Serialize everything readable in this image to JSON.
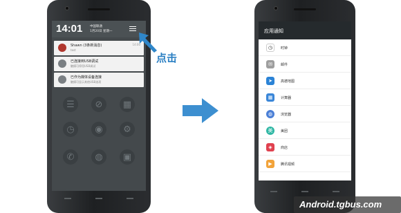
{
  "left_phone": {
    "time": "14:01",
    "date_line1": "中国联通",
    "date_line2": "1月20日 星期一",
    "notifications": [
      {
        "title": "Shawn (3条新消息)",
        "subtitle": "test",
        "time": "14:00",
        "icon_color": "#b0372e"
      },
      {
        "title": "已连接到USB调试",
        "subtitle": "触摸可停用USB调试",
        "time": "",
        "icon_color": "#7a7f83"
      },
      {
        "title": "已作为媒体设备连接",
        "subtitle": "触摸可显示其他USB选项",
        "time": "",
        "icon_color": "#7a7f83"
      }
    ],
    "tiles_row1": [
      "☰",
      "⊘",
      "▦"
    ],
    "tiles_row2": [
      "◷",
      "◉",
      "⚙"
    ],
    "tiles_row3": [
      "✆",
      "◍",
      "▣"
    ]
  },
  "callout_text": "点击",
  "right_phone": {
    "header_title": "应用通知",
    "apps": [
      {
        "label": "时钟",
        "icon": "clock-icon",
        "color": "#ffffff",
        "glyph": "◷"
      },
      {
        "label": "邮件",
        "icon": "mail-icon",
        "color": "#9e9e9e",
        "glyph": "✉"
      },
      {
        "label": "高德地图",
        "icon": "map-icon",
        "color": "#2b83d6",
        "glyph": "➤"
      },
      {
        "label": "计算器",
        "icon": "calculator-icon",
        "color": "#3a86d8",
        "glyph": "▦"
      },
      {
        "label": "浏览器",
        "icon": "browser-icon",
        "color": "#4b7fd6",
        "glyph": "◍"
      },
      {
        "label": "美团",
        "icon": "meituan-icon",
        "color": "#2fb7a4",
        "glyph": "美"
      },
      {
        "label": "商店",
        "icon": "store-icon",
        "color": "#e0414f",
        "glyph": "◈"
      },
      {
        "label": "腾讯视频",
        "icon": "video-icon",
        "color": "#f2a33a",
        "glyph": "▶"
      }
    ]
  },
  "watermark": "Android.tgbus.com"
}
